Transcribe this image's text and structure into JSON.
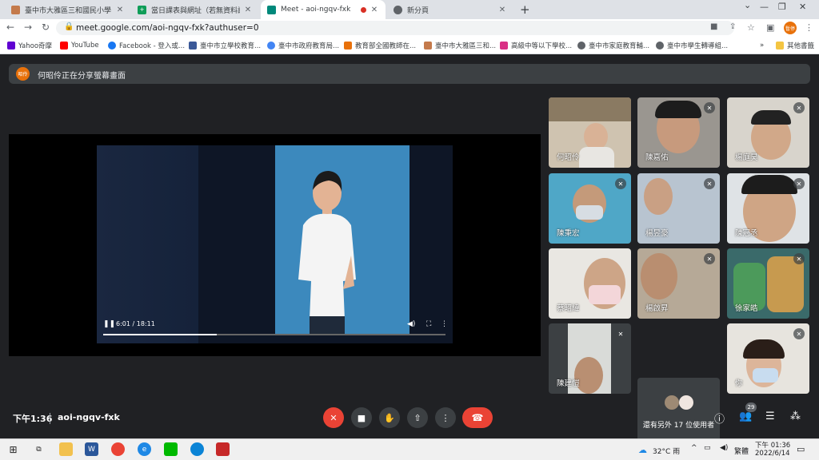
{
  "browser": {
    "tabs": [
      {
        "title": "臺中市大雅區三和國民小學",
        "favicon_color": "#c47a4b"
      },
      {
        "title": "當日課表與網址（若無資料請按F5",
        "favicon_color": "#0f9d58"
      },
      {
        "title": "Meet - aoi-ngqv-fxk",
        "favicon_color": "#00897b"
      },
      {
        "title": "新分頁",
        "favicon_color": "#5f6368"
      }
    ],
    "url": "meet.google.com/aoi-ngqv-fxk?authuser=0",
    "profile_label": "暫停",
    "bookmarks": [
      {
        "label": "Yahoo奇摩",
        "color": "#6001d2"
      },
      {
        "label": "YouTube",
        "color": "#ff0000"
      },
      {
        "label": "Facebook - 登入或...",
        "color": "#1877f2"
      },
      {
        "label": "臺中市立學校教育...",
        "color": "#3b5998"
      },
      {
        "label": "臺中市政府教育局...",
        "color": "#4285f4"
      },
      {
        "label": "教育部全國教師在...",
        "color": "#e8710a"
      },
      {
        "label": "臺中市大雅區三和...",
        "color": "#c47a4b"
      },
      {
        "label": "高級中等以下學校...",
        "color": "#d93085"
      },
      {
        "label": "臺中市家庭教育輔...",
        "color": "#5f6368"
      },
      {
        "label": "臺中市學生轉導組...",
        "color": "#5f6368"
      }
    ],
    "other_bookmarks": "其他書籤"
  },
  "meet": {
    "presenter_avatar": "昭伶",
    "banner_text": "何昭伶正在分享螢幕畫面",
    "video": {
      "time": "6:01 / 18:11",
      "progress": 0.331
    },
    "participants": [
      {
        "name": "何昭伶",
        "muted": false
      },
      {
        "name": "陳嘉佑",
        "muted": true
      },
      {
        "name": "楊庭昊",
        "muted": true
      },
      {
        "name": "陳秉宏",
        "muted": true
      },
      {
        "name": "楊昱豪",
        "muted": true
      },
      {
        "name": "陳冠丞",
        "muted": true
      },
      {
        "name": "蔡昭緯",
        "muted": true
      },
      {
        "name": "楊啟昇",
        "muted": true
      },
      {
        "name": "徐家皓",
        "muted": true
      },
      {
        "name": "陳建愷",
        "muted": true
      },
      {
        "name": "你",
        "muted": true
      }
    ],
    "others_text": "還有另外 17 位使用者",
    "time": "下午1:36",
    "meeting_code": "aoi-ngqv-fxk",
    "people_count": "29"
  },
  "taskbar": {
    "weather": "32°C 雨",
    "input_mode": "繁體",
    "clock_time": "下午 01:36",
    "clock_date": "2022/6/14"
  }
}
